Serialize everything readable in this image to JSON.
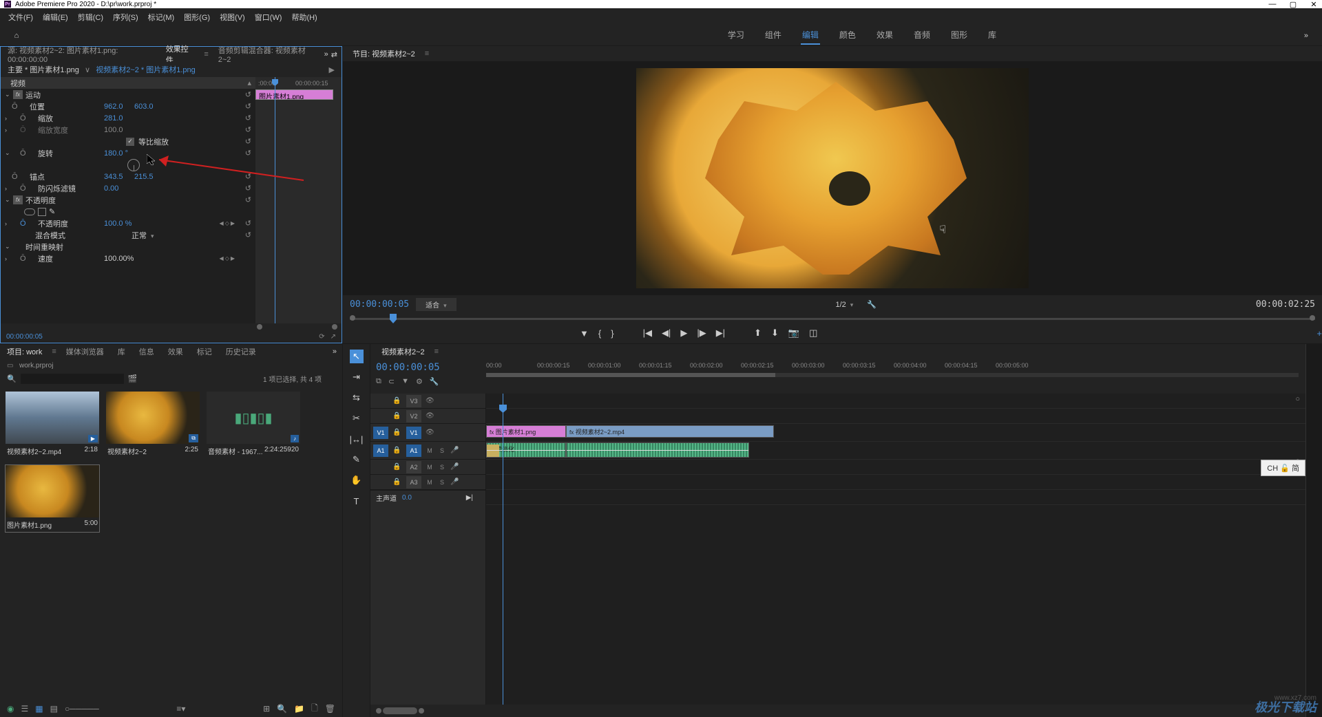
{
  "app": {
    "title": "Adobe Premiere Pro 2020 - D:\\pr\\work.prproj *",
    "menus": [
      "文件(F)",
      "编辑(E)",
      "剪辑(C)",
      "序列(S)",
      "标记(M)",
      "图形(G)",
      "视图(V)",
      "窗口(W)",
      "帮助(H)"
    ]
  },
  "workspaces": {
    "items": [
      "学习",
      "组件",
      "编辑",
      "颜色",
      "效果",
      "音频",
      "图形",
      "库"
    ],
    "active_index": 2
  },
  "source_tabs": {
    "source": "源: 视频素材2~2: 图片素材1.png: 00:00:00:00",
    "effect_controls": "效果控件",
    "audio_mixer": "音频剪辑混合器: 视频素材2~2"
  },
  "effect_controls": {
    "master_clip": "主要 * 图片素材1.png",
    "nested": "视频素材2~2 * 图片素材1.png",
    "ruler_start": ":00:00",
    "ruler_end": "00:00:00:15",
    "clip_label": "图片素材1.png",
    "video_section": "视频",
    "motion": {
      "label": "运动",
      "position": {
        "label": "位置",
        "x": "962.0",
        "y": "603.0"
      },
      "scale": {
        "label": "缩放",
        "value": "281.0"
      },
      "scale_width": {
        "label": "缩放宽度",
        "value": "100.0"
      },
      "uniform": {
        "label": "等比缩放",
        "checked": true
      },
      "rotation": {
        "label": "旋转",
        "value": "180.0 °"
      },
      "anchor": {
        "label": "锚点",
        "x": "343.5",
        "y": "215.5"
      },
      "flicker": {
        "label": "防闪烁滤镜",
        "value": "0.00"
      }
    },
    "opacity": {
      "label": "不透明度",
      "value_label": "不透明度",
      "value": "100.0 %",
      "blend_label": "混合模式",
      "blend_value": "正常"
    },
    "time_remap": {
      "label": "时间重映射",
      "speed_label": "速度",
      "speed_value": "100.00%"
    },
    "footer_tc": "00:00:00:05"
  },
  "project": {
    "tabs": [
      "项目: work",
      "媒体浏览器",
      "库",
      "信息",
      "效果",
      "标记",
      "历史记录"
    ],
    "filename": "work.prproj",
    "search_placeholder": "",
    "info": "1 项已选择, 共 4 项",
    "bins": [
      {
        "name": "视频素材2~2.mp4",
        "dur": "2:18",
        "type": "vid"
      },
      {
        "name": "视频素材2~2",
        "dur": "2:25",
        "type": "seq"
      },
      {
        "name": "音频素材 - 1967...",
        "dur": "2:24:25920",
        "type": "aud"
      },
      {
        "name": "图片素材1.png",
        "dur": "5:00",
        "type": "img"
      }
    ]
  },
  "program": {
    "tab": "节目: 视频素材2~2",
    "timecode": "00:00:00:05",
    "fit": "适合",
    "scale": "1/2",
    "duration": "00:00:02:25"
  },
  "timeline": {
    "tab": "视频素材2~2",
    "timecode": "00:00:00:05",
    "ticks": [
      "00:00",
      "00:00:00:15",
      "00:00:01:00",
      "00:00:01:15",
      "00:00:02:00",
      "00:00:02:15",
      "00:00:03:00",
      "00:00:03:15",
      "00:00:04:00",
      "00:00:04:15",
      "00:00:05:00"
    ],
    "tracks": {
      "v3": "V3",
      "v2": "V2",
      "v1": "V1",
      "a1": "A1",
      "a2": "A2",
      "a3": "A3",
      "v1_src": "V1",
      "a1_src": "A1"
    },
    "clips": {
      "img": "图片素材1.png",
      "vid": "视频素材2~2.mp4",
      "aud_trans": "持续淡化"
    },
    "master": "主声道",
    "master_val": "0.0",
    "toggles": {
      "m": "M",
      "s": "S"
    }
  },
  "ime": "CH 🔓 简",
  "watermark": "极光下载站",
  "watermark_url": "www.xz7.com"
}
